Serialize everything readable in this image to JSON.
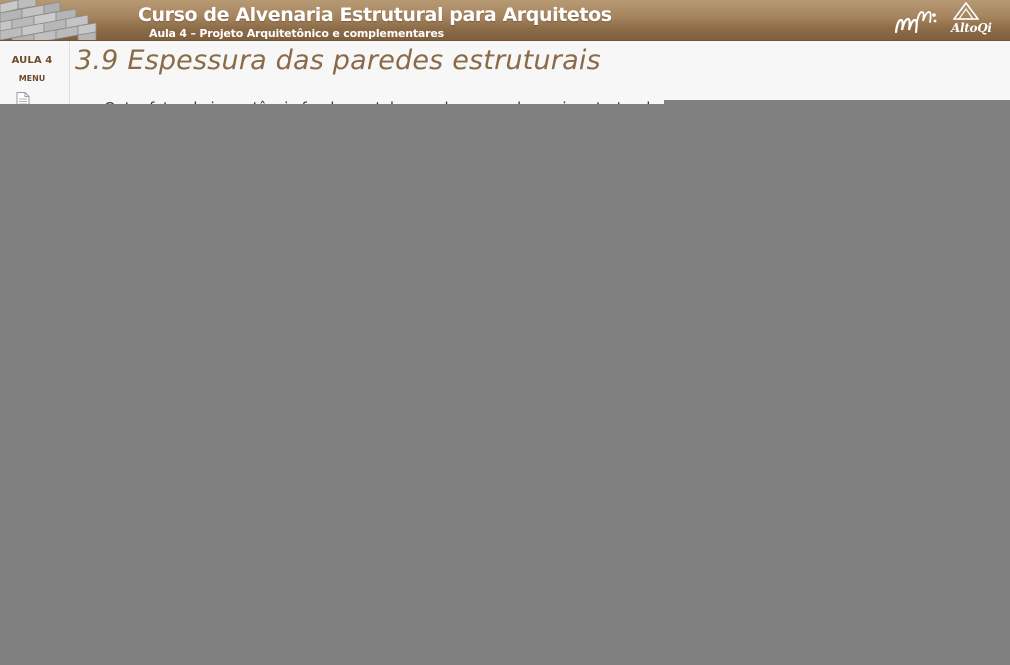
{
  "header": {
    "course_title": "Curso de Alvenaria Estrutural para Arquitetos",
    "course_subtitle": "Aula 4 – Projeto Arquitetônico e complementares",
    "logos": {
      "left": "brick-wall-image",
      "partner": "mm-logo",
      "brand": "AltoQi"
    }
  },
  "sidebar": {
    "lesson_label": "AULA 4",
    "menu_label": "MENU",
    "icons": [
      "document-icon"
    ]
  },
  "main": {
    "section_title": "3.9 Espessura das paredes estruturais",
    "body_text": "Outro fator de importância fundamental para obras em alvenaria estrutural"
  },
  "overlay": {
    "color": "#808080"
  },
  "colors": {
    "header_brown": "#9c7b56",
    "title_brown": "#8a6a48",
    "sidebar_text": "#6e4c2b",
    "background": "#f7f7f7"
  }
}
